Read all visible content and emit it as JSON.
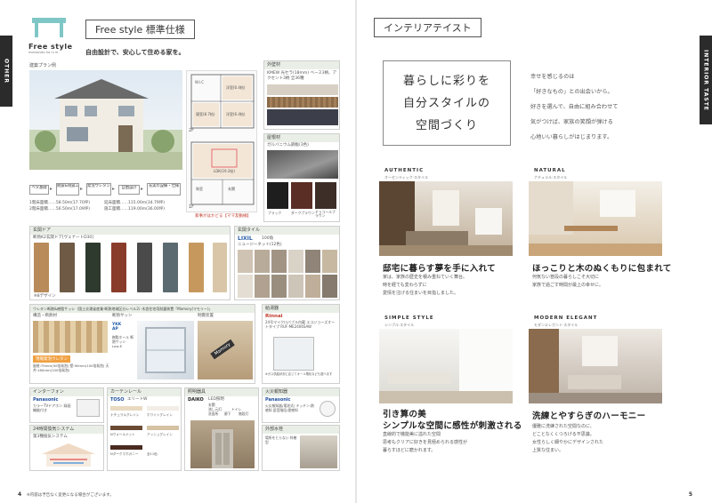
{
  "left_page": {
    "side_tab": "OTHER",
    "section_title": "Free style 標準仕様",
    "logo_text": "Free style",
    "logo_sub": "momoroku ha ru ie",
    "tagline": "自由設計で、安心して住める家を。",
    "model_plan_label": "建築プラン例",
    "floor_2f": "2F",
    "floor_1f": "1F",
    "rooms": [
      "W.I.C",
      "洋室(6.4帖)",
      "寝室(8.7帖)",
      "洋室(6.4帖)",
      "LDK(19.2帖)",
      "和室",
      "玄関"
    ],
    "features": [
      "ベタ基礎",
      "耐震&制震工法",
      "発泡ウレタン断熱",
      "自由設計",
      "充実の設備・仕様"
    ],
    "areas": {
      "floor1": "1階床面積……58.50m(17.70坪)",
      "floor2": "2階床面積……56.50m(17.09坪)",
      "total": "延床面積……115.00m(34.79坪)",
      "construction": "施工面積……119.00m(36.00坪)"
    },
    "housework_note": "家事がはかどる【ママ友動線】",
    "exterior_wall": {
      "title": "外壁材",
      "desc": "KMEW 光セラ(18mm) ベース3柄、アクセント3柄 全36種"
    },
    "roof": {
      "title": "屋根材",
      "desc": "ガルバニウム鋼板(3色)",
      "colors": [
        "ブラック",
        "ダークブラウン",
        "チョコールブラウン"
      ]
    },
    "door": {
      "title": "玄関ドア",
      "desc": "断熱K2玄関ドア[ヴェナートD30]",
      "count": "※8デザイン"
    },
    "tile": {
      "title": "玄関タイル",
      "brand": "LIXIL",
      "count": "100角",
      "desc": "ニュージーネット(12色)"
    },
    "insulation": {
      "title": "ウレタン断熱&樹脂サッシ（国土交通省産業·断熱地域区分レベル2）·木造住宅用耐震装置「Mamory(マモリー)」",
      "sub1": "構造・断熱材",
      "sub2": "断熱サッシ",
      "sub3": "制震装置",
      "urethane": "現場発泡ウレタン",
      "thickness": "屋根:75mm(50倍発泡) 壁:90mm(100倍発泡) 天井:160mm(100倍発泡)",
      "sash_brand": "YKK AP",
      "sash_desc": "樹脂ホール 断熱サッシ Low-E",
      "mamory": "Mamory"
    },
    "water_heater": {
      "title": "給湯器",
      "brand": "Rinnai",
      "desc": "24号マイクロバブル内蔵 エコジョーズオートタイプ RUF-ME2406SAW",
      "note": "※ガス供給状況に応じてオール電化なども選べます"
    },
    "intercom": {
      "title": "インターフォン",
      "brand": "Panasonic",
      "desc": "カラーTVドアホン 録画機能付き"
    },
    "curtain": {
      "title": "カーテンレール",
      "brand": "TOSO",
      "model": "エリートW",
      "colors": [
        "ナチュラルグレイン",
        "ホワイトグレイン",
        "Nウォールナット",
        "アッシュグレイン",
        "Nダークマホガニー"
      ],
      "count": "全11色"
    },
    "lighting": {
      "title": "照明器具",
      "brand": "DAIKO",
      "desc": "LED照明",
      "places": [
        "玄関",
        "流し元灯",
        "トイレ",
        "洗面所",
        "廊下",
        "階段灯"
      ]
    },
    "alarm": {
      "title": "火災報知器",
      "brand": "Panasonic",
      "desc": "火災報知器(電池式) キッチン:熱感知 居室階段:煙感知"
    },
    "ventilation": {
      "title": "24時間換気システム",
      "desc": "第3種換気システム"
    },
    "faucet": {
      "title": "外部水栓",
      "desc": "場所をとらない 枠樹型"
    },
    "footnote": "※内容は予告なく変更になる場合がございます。",
    "page_number": "4"
  },
  "right_page": {
    "side_tab": "INTERIOR TASTE",
    "section_title": "インテリアテイスト",
    "hero_lines": [
      "暮らしに彩りを",
      "自分スタイルの",
      "空間づくり"
    ],
    "intro_lines": [
      "幸せを感じるのは",
      "「好きなもの」との出会いから。",
      "好きを選んで、自由に組み合わせて",
      "気がつけば、家族の笑顔が弾ける",
      "心地いい暮らしがはじまります。"
    ],
    "styles": [
      {
        "tag": "AUTHENTIC",
        "sub": "オーセンティック·スタイル",
        "heading": "邸宅に暮らす夢を手に入れて",
        "body": [
          "家は、家族の歴史を積み重ねていく舞台。",
          "時を経ても変わらずに",
          "愛情を注げる住まいを目指しました。"
        ]
      },
      {
        "tag": "NATURAL",
        "sub": "ナチュラル·スタイル",
        "heading": "ほっこりと木のぬくもりに包まれて",
        "body": [
          "何気ない普段の暮らしこそ大切に",
          "家族で過ごす時間が最上の幸せに。"
        ]
      },
      {
        "tag": "SIMPLE STYLE",
        "sub": "シンプル·スタイル",
        "heading": "引き算の美",
        "heading2": "シンプルな空間に感性が刺激される",
        "body": [
          "直線的で機能美に溢れた空間",
          "思考もクリアに好きを見極められる感性が",
          "暮らすほどに磨かれます。"
        ]
      },
      {
        "tag": "MODERN ELEGANT",
        "sub": "モダンエレガント·スタイル",
        "heading": "洗練とやすらぎのハーモニー",
        "body": [
          "優雅に洗練された空間なのに、",
          "どことなくくつろげる不思議。",
          "女性らしく細やかにデザインされた",
          "上質な住まい。"
        ]
      }
    ],
    "page_number": "5"
  }
}
